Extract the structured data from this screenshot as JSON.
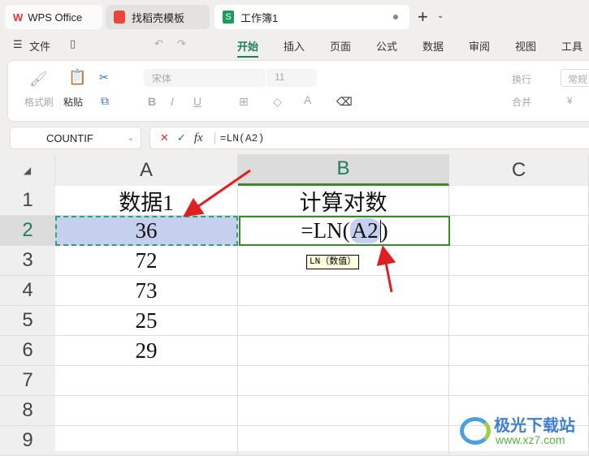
{
  "tabs": [
    {
      "label": "WPS Office",
      "icon": "wps-logo-icon"
    },
    {
      "label": "找稻壳模板",
      "icon": "docer-icon"
    },
    {
      "label": "工作簿1",
      "icon": "spreadsheet-icon"
    }
  ],
  "menu": {
    "file": "文件",
    "items": [
      "开始",
      "插入",
      "页面",
      "公式",
      "数据",
      "审阅",
      "视图",
      "工具"
    ],
    "active": "开始"
  },
  "ribbon": {
    "format_painter": "格式刷",
    "paste": "粘贴",
    "font": "宋体",
    "size": "11",
    "wrap": "换行",
    "merge": "合并",
    "number_format": "常规",
    "currency": "¥"
  },
  "formula": {
    "name_box": "COUNTIF",
    "content": "=LN(A2)",
    "cancel": "✕",
    "confirm": "✓",
    "fx": "fx"
  },
  "sheet": {
    "columns": [
      "A",
      "B",
      "C"
    ],
    "rows": [
      "1",
      "2",
      "3",
      "4",
      "5",
      "6",
      "7",
      "8",
      "9"
    ],
    "cells": {
      "A1": "数据1",
      "B1": "计算对数",
      "A2": "36",
      "A3": "72",
      "A4": "73",
      "A5": "25",
      "A6": "29"
    },
    "edit": {
      "prefix": "=LN(",
      "ref": "A2",
      "suffix": ")"
    },
    "tooltip": "LN（数值）"
  },
  "watermark": {
    "name": "极光下载站",
    "url": "www.xz7.com"
  },
  "colors": {
    "accent": "#1a7f5a",
    "selection": "#c5d0ee",
    "arrow": "#e02020"
  }
}
